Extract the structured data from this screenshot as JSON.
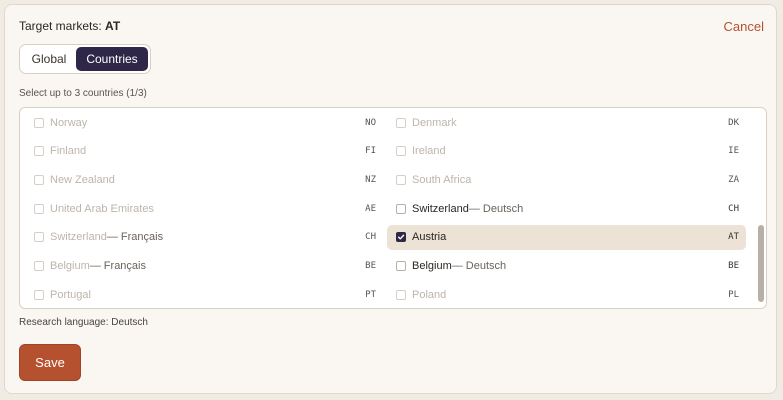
{
  "header": {
    "label": "Target markets:",
    "value": "AT",
    "cancel": "Cancel"
  },
  "toggle": {
    "options": [
      "Global",
      "Countries"
    ],
    "selected": "Countries"
  },
  "hint": "Select up to 3 countries (1/3)",
  "countries": {
    "left": [
      {
        "name": "Norway",
        "variant": "",
        "code": "NO",
        "checked": false,
        "enabled": false
      },
      {
        "name": "Finland",
        "variant": "",
        "code": "FI",
        "checked": false,
        "enabled": false
      },
      {
        "name": "New Zealand",
        "variant": "",
        "code": "NZ",
        "checked": false,
        "enabled": false
      },
      {
        "name": "United Arab Emirates",
        "variant": "",
        "code": "AE",
        "checked": false,
        "enabled": false
      },
      {
        "name": "Switzerland",
        "variant": " — Français",
        "code": "CH",
        "checked": false,
        "enabled": false
      },
      {
        "name": "Belgium",
        "variant": " — Français",
        "code": "BE",
        "checked": false,
        "enabled": false
      },
      {
        "name": "Portugal",
        "variant": "",
        "code": "PT",
        "checked": false,
        "enabled": false
      }
    ],
    "right": [
      {
        "name": "Denmark",
        "variant": "",
        "code": "DK",
        "checked": false,
        "enabled": false
      },
      {
        "name": "Ireland",
        "variant": "",
        "code": "IE",
        "checked": false,
        "enabled": false
      },
      {
        "name": "South Africa",
        "variant": "",
        "code": "ZA",
        "checked": false,
        "enabled": false
      },
      {
        "name": "Switzerland",
        "variant": " — Deutsch",
        "code": "CH",
        "checked": false,
        "enabled": true
      },
      {
        "name": "Austria",
        "variant": "",
        "code": "AT",
        "checked": true,
        "enabled": true
      },
      {
        "name": "Belgium",
        "variant": " — Deutsch",
        "code": "BE",
        "checked": false,
        "enabled": true
      },
      {
        "name": "Poland",
        "variant": "",
        "code": "PL",
        "checked": false,
        "enabled": false
      }
    ]
  },
  "research_language": "Research language: Deutsch",
  "save_label": "Save",
  "colors": {
    "accent": "#b5512f",
    "selected_toggle": "#2e2748",
    "selected_row": "#ece2d5"
  },
  "icons": {
    "checkbox_checked": "checkmark-icon"
  }
}
